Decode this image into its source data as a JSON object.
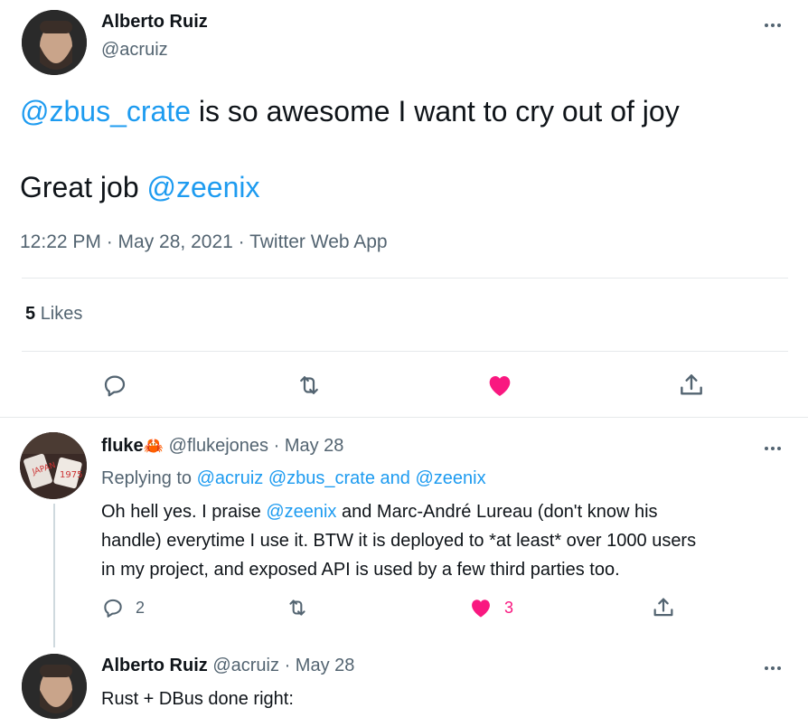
{
  "main_tweet": {
    "author_name": "Alberto Ruiz",
    "author_handle": "@acruiz",
    "text_mention": "@zbus_crate",
    "text_rest": " is so awesome I want to cry out of joy",
    "line2_prefix": "Great job ",
    "line2_mention": "@zeenix",
    "timestamp": "12:22 PM · May 28, 2021 · Twitter Web App",
    "likes_count": "5",
    "likes_label": "Likes"
  },
  "reply1": {
    "author_name": "fluke",
    "author_emoji": "🦀",
    "author_handle": "@flukejones",
    "date": "· May 28",
    "replying_prefix": "Replying to ",
    "replying_to": "@acruiz @zbus_crate and @zeenix",
    "body_before_mention": "Oh hell yes. I praise ",
    "body_mention": "@zeenix",
    "body_after_mention_line1": " and Marc-André Lureau (don't know his",
    "body_line2": "handle) everytime I use it. BTW it is deployed to *at least* over 1000 users",
    "body_line3": "in my project, and exposed API is used by a few third parties too.",
    "reply_count": "2",
    "like_count": "3"
  },
  "reply2": {
    "author_name": "Alberto Ruiz",
    "author_handle": "@acruiz",
    "date": "· May 28",
    "body": "Rust + DBus done right:"
  },
  "icons": {
    "reply": "reply-icon",
    "retweet": "retweet-icon",
    "like": "heart-icon",
    "share": "share-icon",
    "more": "more-icon"
  },
  "colors": {
    "link": "#1d9bf0",
    "like": "#f91880",
    "muted": "#536471"
  }
}
